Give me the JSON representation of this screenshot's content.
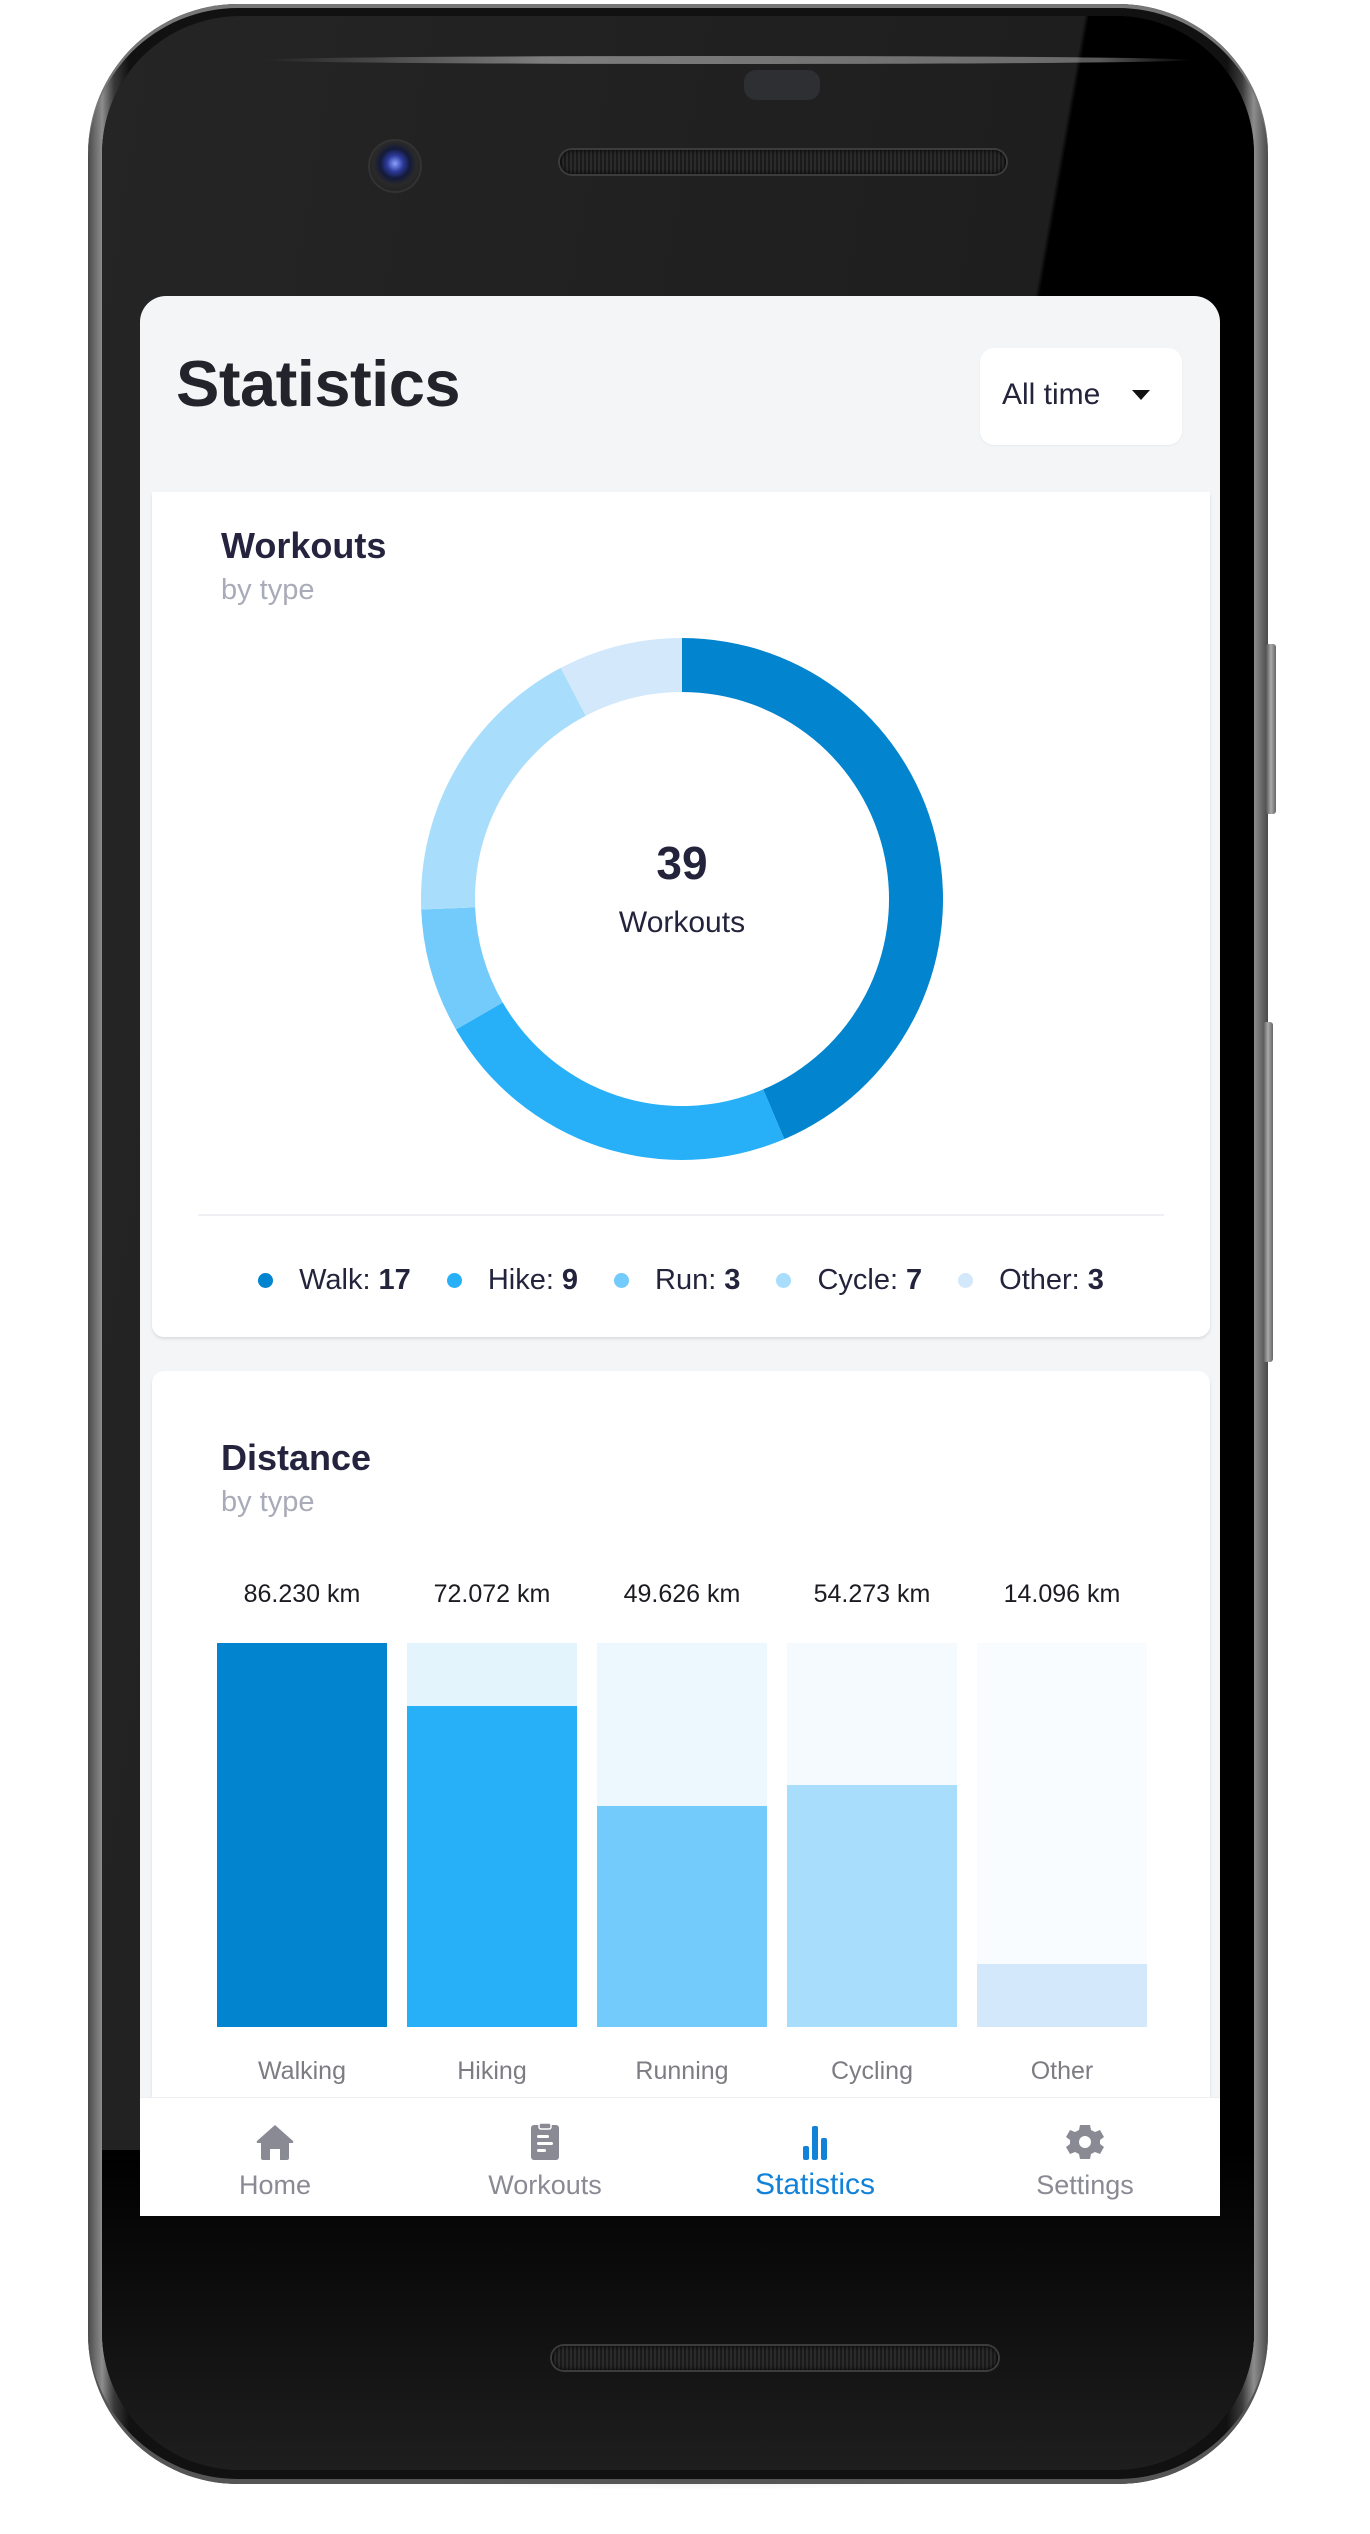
{
  "app": {
    "title": "Statistics",
    "range_select": {
      "value": "All time",
      "icon": "caret-down-icon"
    }
  },
  "workouts_card": {
    "title": "Workouts",
    "subtitle": "by type",
    "total": "39",
    "total_label": "Workouts",
    "legend": [
      {
        "label": "Walk:",
        "value": "17",
        "color": "#0284ce"
      },
      {
        "label": "Hike:",
        "value": "9",
        "color": "#27b0f8"
      },
      {
        "label": "Run:",
        "value": "3",
        "color": "#72cbfa"
      },
      {
        "label": "Cycle:",
        "value": "7",
        "color": "#a8ddfb"
      },
      {
        "label": "Other:",
        "value": "3",
        "color": "#d3e8fa"
      }
    ]
  },
  "distance_card": {
    "title": "Distance",
    "subtitle": "by type"
  },
  "chart_data": [
    {
      "type": "pie",
      "variant": "donut",
      "title": "Workouts",
      "subtitle": "by type",
      "center_value": 39,
      "center_label": "Workouts",
      "categories": [
        "Walk",
        "Hike",
        "Run",
        "Cycle",
        "Other"
      ],
      "values": [
        17,
        9,
        3,
        7,
        3
      ],
      "colors": [
        "#0284ce",
        "#27b0f8",
        "#72cbfa",
        "#a8ddfb",
        "#d3e8fa"
      ],
      "direction": "clockwise-from-top",
      "legend": "bottom"
    },
    {
      "type": "bar",
      "title": "Distance",
      "subtitle": "by type",
      "unit": "km",
      "categories": [
        "Walking",
        "Hiking",
        "Running",
        "Cycling",
        "Other"
      ],
      "values": [
        86.23,
        72.072,
        49.626,
        54.273,
        14.096
      ],
      "value_labels": [
        "86.230 km",
        "72.072 km",
        "49.626 km",
        "54.273 km",
        "14.096 km"
      ],
      "colors": [
        "#0284ce",
        "#27b0f8",
        "#72cbfa",
        "#a8ddfb",
        "#d3e8fa"
      ],
      "track_colors": [
        "#0284ce",
        "#e4f4fd",
        "#ecf7fe",
        "#f4fafe",
        "#f9fcff"
      ],
      "ylim": [
        0,
        86.23
      ],
      "grid": false,
      "xlabel": "",
      "ylabel": ""
    }
  ],
  "bottom_nav": [
    {
      "label": "Home",
      "icon": "home-icon",
      "active": false
    },
    {
      "label": "Workouts",
      "icon": "clipboard-icon",
      "active": false
    },
    {
      "label": "Statistics",
      "icon": "bar-chart-icon",
      "active": true
    },
    {
      "label": "Settings",
      "icon": "gear-icon",
      "active": false
    }
  ],
  "colors": {
    "accent": "#1282d8",
    "inactive": "#8a8a94",
    "text": "#23233c",
    "background": "#f3f5f7"
  }
}
